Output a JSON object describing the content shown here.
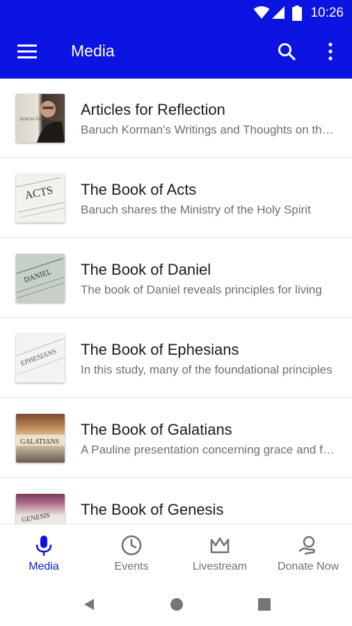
{
  "status_bar": {
    "time": "10:26"
  },
  "toolbar": {
    "title": "Media"
  },
  "items": [
    {
      "title": "Articles for Reflection",
      "subtitle": "Baruch Korman's Writings and Thoughts on the Scriptures",
      "thumb_text": "Articles for Reflection"
    },
    {
      "title": "The Book of Acts",
      "subtitle": "Baruch shares the Ministry of the Holy Spirit",
      "thumb_text": "ACTS"
    },
    {
      "title": "The Book of Daniel",
      "subtitle": "The book of Daniel reveals principles for living",
      "thumb_text": "DANIEL"
    },
    {
      "title": "The Book of Ephesians",
      "subtitle": "In this study, many of the foundational principles",
      "thumb_text": "EPHESIANS"
    },
    {
      "title": "The Book of Galatians",
      "subtitle": "A Pauline presentation concerning grace and faith",
      "thumb_text": "GALATIANS"
    },
    {
      "title": "The Book of Genesis",
      "subtitle": "",
      "thumb_text": "GENESIS"
    }
  ],
  "bottom_nav": [
    {
      "label": "Media",
      "icon": "microphone-icon",
      "active": true
    },
    {
      "label": "Events",
      "icon": "clock-icon",
      "active": false
    },
    {
      "label": "Livestream",
      "icon": "crown-icon",
      "active": false
    },
    {
      "label": "Donate Now",
      "icon": "donate-hand-icon",
      "active": false
    }
  ],
  "colors": {
    "primary": "#0b14e0",
    "text": "#1b1b1b",
    "subtext": "#6e6e6e",
    "nav_inactive": "#707070"
  }
}
